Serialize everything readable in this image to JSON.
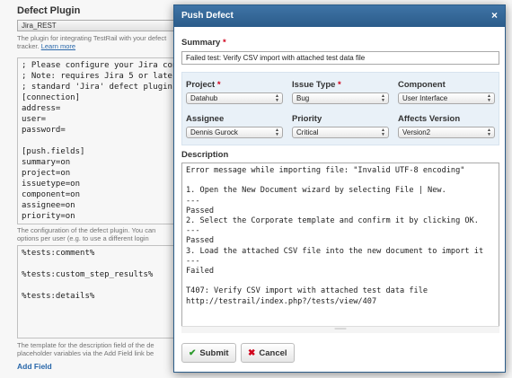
{
  "background": {
    "title": "Defect Plugin",
    "plugin_value": "Jira_REST",
    "help_top": "The plugin for integrating TestRail with your defect",
    "help_top_2": "tracker. ",
    "learn_more": "Learn more",
    "config_lines": "; Please configure your Jira conne\n; Note: requires Jira 5 or later.\n; standard 'Jira' defect plugin fo\n[connection]\naddress=\nuser=\npassword=\n\n[push.fields]\nsummary=on\nproject=on\nissuetype=on\ncomponent=on\nassignee=on\npriority=on",
    "help_mid": "The configuration of the defect plugin. You can",
    "help_mid_2": "options per user (e.g. to use a different login",
    "template_lines": "%tests:comment%\n\n%tests:custom_step_results%\n\n%tests:details%",
    "help_bottom": "The template for the description field of the de",
    "help_bottom_2": "placeholder variables via the Add Field link be",
    "add_field": "Add Field"
  },
  "dialog": {
    "title": "Push Defect",
    "close_glyph": "×",
    "summary_label": "Summary",
    "required_mark": "*",
    "summary_value": "Failed test: Verify CSV import with attached test data file",
    "fields": {
      "project": {
        "label": "Project",
        "value": "Datahub"
      },
      "issue_type": {
        "label": "Issue Type",
        "value": "Bug"
      },
      "component": {
        "label": "Component",
        "value": "User Interface"
      },
      "assignee": {
        "label": "Assignee",
        "value": "Dennis Gurock"
      },
      "priority": {
        "label": "Priority",
        "value": "Critical"
      },
      "affects_version": {
        "label": "Affects Version",
        "value": "Version2"
      }
    },
    "description_label": "Description",
    "description_value": "Error message while importing file: \"Invalid UTF-8 encoding\"\n\n1. Open the New Document wizard by selecting File | New.\n---\nPassed\n2. Select the Corporate template and confirm it by clicking OK.\n---\nPassed\n3. Load the attached CSV file into the new document to import it\n---\nFailed\n\nT407: Verify CSV import with attached test data file\nhttp://testrail/index.php?/tests/view/407",
    "submit_label": "Submit",
    "cancel_label": "Cancel",
    "submit_icon": "check-icon",
    "cancel_icon": "x-icon"
  },
  "colors": {
    "header": "#3f74a6",
    "fields_bg": "#e9f1f8",
    "required": "#d0021b",
    "link": "#2a6bb0"
  }
}
